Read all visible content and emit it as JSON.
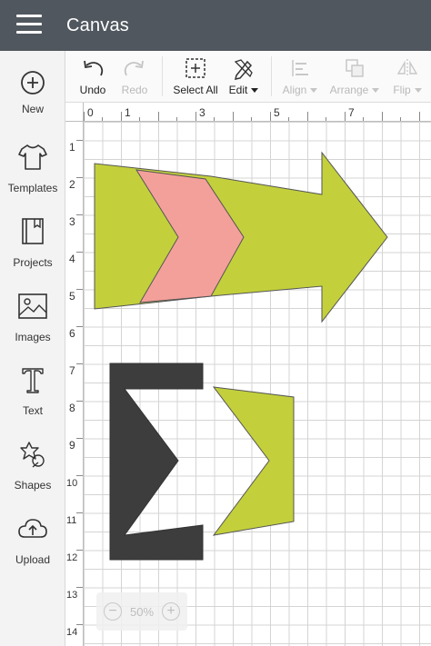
{
  "app": {
    "title": "Canvas"
  },
  "sidebar": {
    "items": [
      {
        "label": "New",
        "icon": "plus-circle-icon"
      },
      {
        "label": "Templates",
        "icon": "tshirt-icon"
      },
      {
        "label": "Projects",
        "icon": "book-icon"
      },
      {
        "label": "Images",
        "icon": "image-icon"
      },
      {
        "label": "Text",
        "icon": "text-t-icon"
      },
      {
        "label": "Shapes",
        "icon": "shapes-icon"
      },
      {
        "label": "Upload",
        "icon": "cloud-upload-icon"
      }
    ]
  },
  "toolbar": {
    "undo": "Undo",
    "redo": "Redo",
    "select_all": "Select All",
    "edit": "Edit",
    "align": "Align",
    "arrange": "Arrange",
    "flip": "Flip"
  },
  "rulers": {
    "top": [
      "0",
      "1",
      "3",
      "5",
      "7"
    ],
    "left": [
      "1",
      "2",
      "3",
      "4",
      "5",
      "6",
      "7",
      "8",
      "9",
      "10",
      "11",
      "12",
      "13",
      "14"
    ]
  },
  "shapes": {
    "colors": {
      "green": "#c3d03b",
      "pink": "#f4a09a",
      "dark": "#3d3d3d"
    }
  },
  "zoom": {
    "value": "50%",
    "minus": "−",
    "plus": "+"
  }
}
